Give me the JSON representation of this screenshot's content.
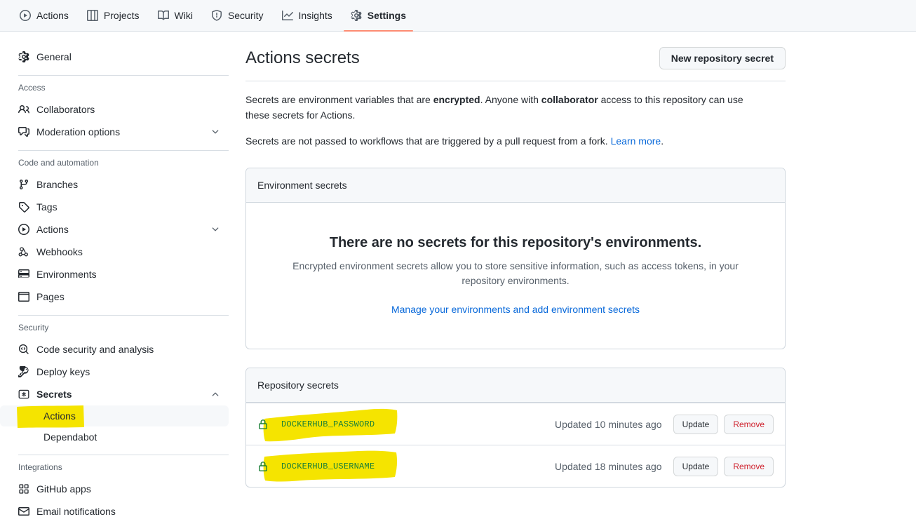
{
  "repo_nav": {
    "tabs": [
      {
        "label": "Actions",
        "icon": "play-circle-icon",
        "active": false
      },
      {
        "label": "Projects",
        "icon": "table-icon",
        "active": false
      },
      {
        "label": "Wiki",
        "icon": "book-icon",
        "active": false
      },
      {
        "label": "Security",
        "icon": "shield-icon",
        "active": false
      },
      {
        "label": "Insights",
        "icon": "graph-icon",
        "active": false
      },
      {
        "label": "Settings",
        "icon": "gear-icon",
        "active": true
      }
    ],
    "active_underline_color": "#fd8c73"
  },
  "sidebar": {
    "general": {
      "label": "General",
      "icon": "gear-icon"
    },
    "sections": [
      {
        "heading": "Access",
        "items": [
          {
            "label": "Collaborators",
            "icon": "people-icon",
            "chevron": ""
          },
          {
            "label": "Moderation options",
            "icon": "comment-discussion-icon",
            "chevron": "down"
          }
        ]
      },
      {
        "heading": "Code and automation",
        "items": [
          {
            "label": "Branches",
            "icon": "git-branch-icon",
            "chevron": ""
          },
          {
            "label": "Tags",
            "icon": "tag-icon",
            "chevron": ""
          },
          {
            "label": "Actions",
            "icon": "play-circle-icon",
            "chevron": "down"
          },
          {
            "label": "Webhooks",
            "icon": "webhook-icon",
            "chevron": ""
          },
          {
            "label": "Environments",
            "icon": "server-icon",
            "chevron": ""
          },
          {
            "label": "Pages",
            "icon": "browser-icon",
            "chevron": ""
          }
        ]
      },
      {
        "heading": "Security",
        "items": [
          {
            "label": "Code security and analysis",
            "icon": "codescan-icon",
            "chevron": ""
          },
          {
            "label": "Deploy keys",
            "icon": "key-icon",
            "chevron": ""
          },
          {
            "label": "Secrets",
            "icon": "secret-asterisk-icon",
            "chevron": "up",
            "bold": true
          }
        ],
        "subitems": [
          {
            "label": "Actions",
            "selected": true,
            "highlighted": true
          },
          {
            "label": "Dependabot",
            "selected": false,
            "highlighted": false
          }
        ]
      },
      {
        "heading": "Integrations",
        "items": [
          {
            "label": "GitHub apps",
            "icon": "apps-grid-icon",
            "chevron": ""
          },
          {
            "label": "Email notifications",
            "icon": "mail-icon",
            "chevron": ""
          }
        ]
      }
    ]
  },
  "main": {
    "title": "Actions secrets",
    "new_secret_button": "New repository secret",
    "description_1": {
      "part_1": "Secrets are environment variables that are ",
      "bold_1": "encrypted",
      "part_2": ". Anyone with ",
      "bold_2": "collaborator",
      "part_3": " access to this repository can use these secrets for Actions."
    },
    "description_2": {
      "part_1": "Secrets are not passed to workflows that are triggered by a pull request from a fork. ",
      "link": "Learn more",
      "part_2": "."
    },
    "environment_secrets": {
      "header": "Environment secrets",
      "blank_title": "There are no secrets for this repository's environments.",
      "blank_text": "Encrypted environment secrets allow you to store sensitive information, such as access tokens, in your repository environments.",
      "blank_link": "Manage your environments and add environment secrets"
    },
    "repository_secrets": {
      "header": "Repository secrets",
      "rows": [
        {
          "name": "DOCKERHUB_PASSWORD",
          "updated": "Updated 10 minutes ago",
          "update_label": "Update",
          "remove_label": "Remove",
          "highlighted": true
        },
        {
          "name": "DOCKERHUB_USERNAME",
          "updated": "Updated 18 minutes ago",
          "update_label": "Update",
          "remove_label": "Remove",
          "highlighted": true
        }
      ]
    }
  },
  "colors": {
    "accent": "#0969da",
    "active_tab_underline": "#fd8c73",
    "secret_green": "#1a7f37",
    "danger": "#cf222e",
    "highlighter": "#f5e400"
  }
}
